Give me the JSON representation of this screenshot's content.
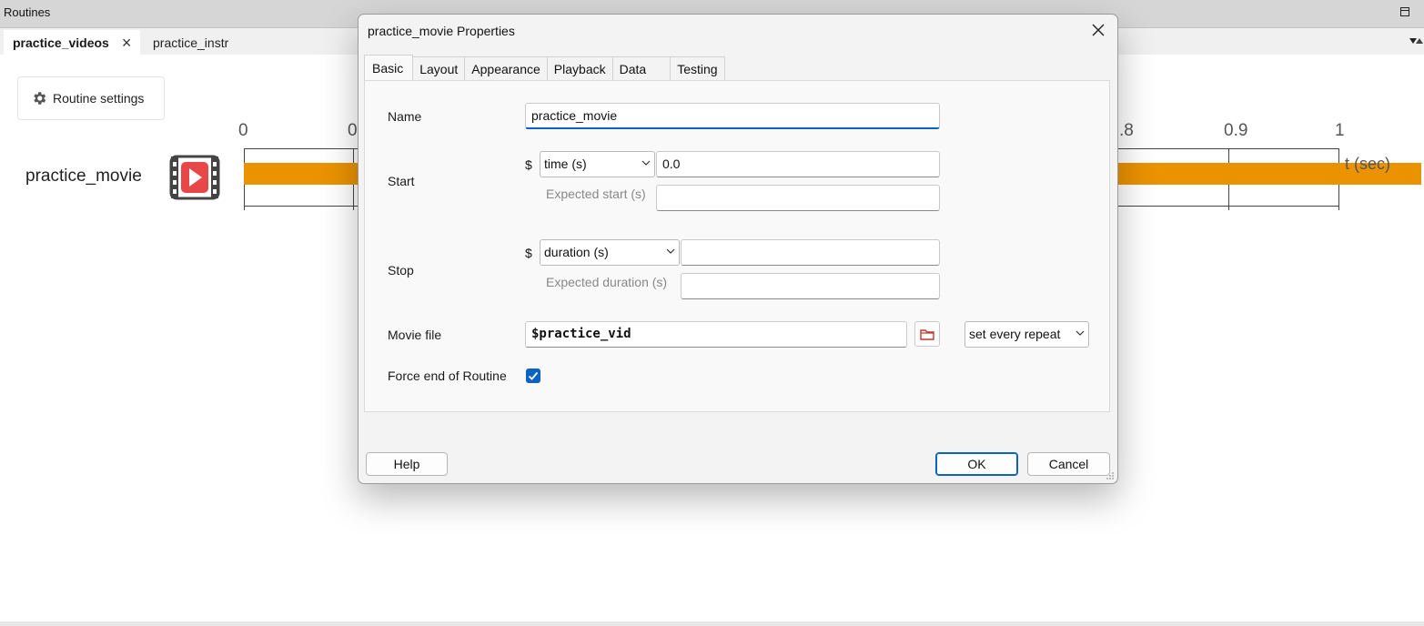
{
  "panel": {
    "title": "Routines",
    "tabs": [
      {
        "label": "practice_videos",
        "active": true
      },
      {
        "label": "practice_instr",
        "active": false
      }
    ]
  },
  "routine": {
    "settings_label": "Routine settings",
    "component_name": "practice_movie",
    "timeline": {
      "tick_labels": [
        "0",
        "0",
        ".8",
        "0.9",
        "1"
      ],
      "axis_label": "t (sec)",
      "bar_color": "#ea9200"
    }
  },
  "dialog": {
    "title": "practice_movie Properties",
    "tabs": [
      "Basic",
      "Layout",
      "Appearance",
      "Playback",
      "Data",
      "Testing"
    ],
    "active_tab": "Basic",
    "fields": {
      "name_label": "Name",
      "name_value": "practice_movie",
      "start_label": "Start",
      "start_dollar": "$",
      "start_type": "time (s)",
      "start_value": "0.0",
      "expected_start_label": "Expected start (s)",
      "expected_start_value": "",
      "stop_label": "Stop",
      "stop_dollar": "$",
      "stop_type": "duration (s)",
      "stop_value": "",
      "expected_duration_label": "Expected duration (s)",
      "expected_duration_value": "",
      "movie_label": "Movie file",
      "movie_value": "$practice_vid",
      "movie_update": "set every repeat",
      "force_end_label": "Force end of Routine",
      "force_end_checked": true
    },
    "buttons": {
      "help": "Help",
      "ok": "OK",
      "cancel": "Cancel"
    }
  },
  "colors": {
    "accent": "#0b62c2",
    "movie_icon": "#e8474a"
  }
}
